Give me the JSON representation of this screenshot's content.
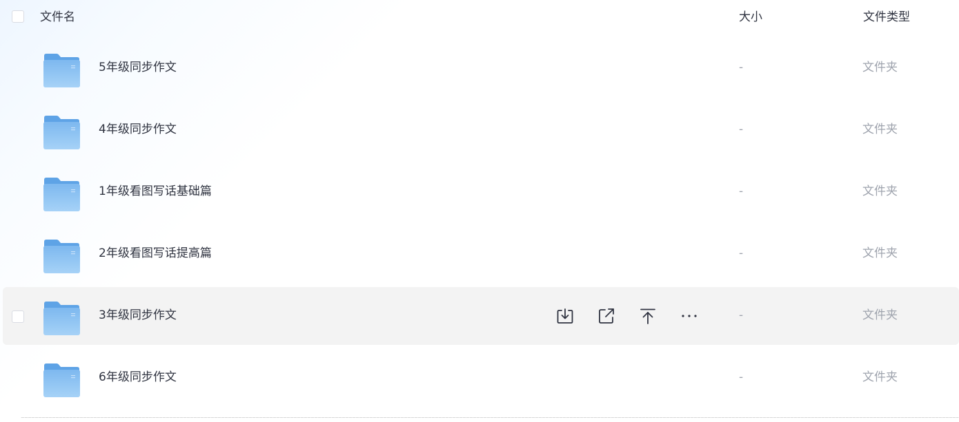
{
  "header": {
    "name_label": "文件名",
    "size_label": "大小",
    "type_label": "文件类型"
  },
  "rows": [
    {
      "name": "5年级同步作文",
      "size": "-",
      "type": "文件夹"
    },
    {
      "name": "4年级同步作文",
      "size": "-",
      "type": "文件夹"
    },
    {
      "name": "1年级看图写话基础篇",
      "size": "-",
      "type": "文件夹"
    },
    {
      "name": "2年级看图写话提高篇",
      "size": "-",
      "type": "文件夹"
    },
    {
      "name": "3年级同步作文",
      "size": "-",
      "type": "文件夹"
    },
    {
      "name": "6年级同步作文",
      "size": "-",
      "type": "文件夹"
    }
  ],
  "hovered_row_actions": [
    "download-icon",
    "share-icon",
    "move-to-top-icon",
    "more-icon"
  ],
  "colors": {
    "folder_blue": "#7ab8ee",
    "hover_bg": "#f3f3f3",
    "text": "#2f3340",
    "muted_text": "#9ea3ad"
  }
}
